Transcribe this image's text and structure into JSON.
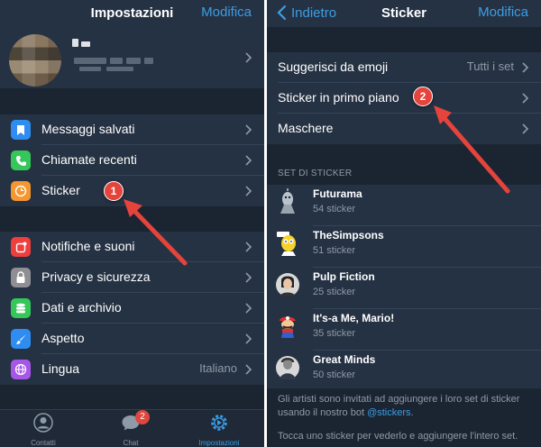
{
  "left": {
    "nav": {
      "title": "Impostazioni",
      "right": "Modifica"
    },
    "profile": {
      "name_blurred": "",
      "phone_blurred": ""
    },
    "group1": [
      {
        "label": "Messaggi salvati",
        "icon": "bookmark-icon",
        "color": "#2f8cf0"
      },
      {
        "label": "Chiamate recenti",
        "icon": "phone-icon",
        "color": "#35c759"
      },
      {
        "label": "Sticker",
        "icon": "sticker-icon",
        "color": "#f5962e"
      }
    ],
    "group2": [
      {
        "label": "Notifiche e suoni",
        "icon": "notification-icon",
        "color": "#ee3e3e",
        "value": ""
      },
      {
        "label": "Privacy e sicurezza",
        "icon": "lock-icon",
        "color": "#8e8e93",
        "value": ""
      },
      {
        "label": "Dati e archivio",
        "icon": "database-icon",
        "color": "#35c759",
        "value": ""
      },
      {
        "label": "Aspetto",
        "icon": "brush-icon",
        "color": "#2f8cf0",
        "value": ""
      },
      {
        "label": "Lingua",
        "icon": "globe-icon",
        "color": "#a657e8",
        "value": "Italiano"
      }
    ],
    "tabs": [
      {
        "label": "Contatti",
        "icon": "contacts-icon",
        "active": false
      },
      {
        "label": "Chat",
        "icon": "chat-icon",
        "active": false,
        "badge": "2"
      },
      {
        "label": "Impostazioni",
        "icon": "settings-icon",
        "active": true
      }
    ],
    "annotation": "1"
  },
  "right": {
    "nav": {
      "back": "Indietro",
      "title": "Sticker",
      "right": "Modifica"
    },
    "options": [
      {
        "label": "Suggerisci da emoji",
        "value": "Tutti i set"
      },
      {
        "label": "Sticker in primo piano",
        "value": ""
      },
      {
        "label": "Maschere",
        "value": ""
      }
    ],
    "section_header": "SET DI STICKER",
    "sets": [
      {
        "name": "Futurama",
        "count": "54 sticker",
        "icon": "futurama-sticker"
      },
      {
        "name": "TheSimpsons",
        "count": "51 sticker",
        "icon": "simpsons-sticker"
      },
      {
        "name": "Pulp Fiction",
        "count": "25 sticker",
        "icon": "pulp-fiction-sticker"
      },
      {
        "name": "It's-a Me, Mario!",
        "count": "35 sticker",
        "icon": "mario-sticker"
      },
      {
        "name": "Great Minds",
        "count": "50 sticker",
        "icon": "great-minds-sticker"
      }
    ],
    "footer1_text": "Gli artisti sono invitati ad aggiungere i loro set di sticker usando il nostro bot ",
    "footer1_link": "@stickers",
    "footer1_end": ".",
    "footer2": "Tocca uno sticker per vederlo e aggiungere l'intero set.",
    "annotation": "2"
  },
  "colors": {
    "accent": "#3b9ee6",
    "annotation": "#e4443c",
    "background": "#1b2532",
    "cell": "#253243"
  }
}
